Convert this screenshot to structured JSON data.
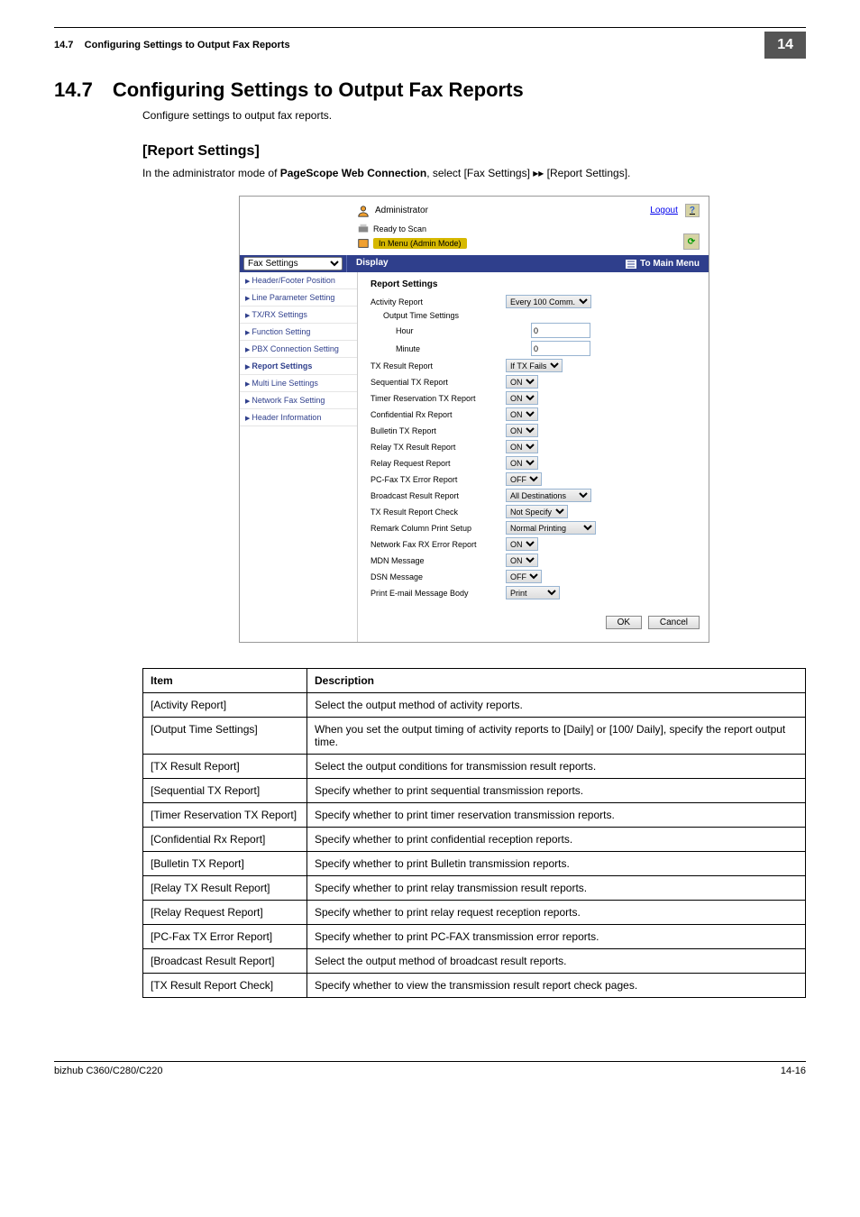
{
  "header": {
    "section_label": "14.7",
    "running_title": "Configuring Settings to Output Fax Reports",
    "chapter_badge": "14"
  },
  "h1": {
    "number": "14.7",
    "title": "Configuring Settings to Output Fax Reports"
  },
  "intro": "Configure settings to output fax reports.",
  "h2": "[Report Settings]",
  "instruction_pre": "In the administrator mode of ",
  "instruction_bold": "PageScope Web Connection",
  "instruction_post": ", select [Fax Settings] ▸▸ [Report Settings].",
  "screenshot": {
    "administrator": "Administrator",
    "logout": "Logout",
    "help": "?",
    "ready": "Ready to Scan",
    "mode": "In Menu (Admin Mode)",
    "dropdown": "Fax Settings",
    "display": "Display",
    "to_main_menu": "To Main Menu",
    "sidebar": [
      "Header/Footer Position",
      "Line Parameter Setting",
      "TX/RX Settings",
      "Function Setting",
      "PBX Connection Setting",
      "Report Settings",
      "Multi Line Settings",
      "Network Fax Setting",
      "Header Information"
    ],
    "panel_title": "Report Settings",
    "rows": {
      "activity_report": {
        "l": "Activity Report",
        "v": "Every 100 Comm."
      },
      "output_time": {
        "l": "Output Time Settings"
      },
      "hour": {
        "l": "Hour",
        "v": "0"
      },
      "minute": {
        "l": "Minute",
        "v": "0"
      },
      "tx_result": {
        "l": "TX Result Report",
        "v": "If TX Fails"
      },
      "seq_tx": {
        "l": "Sequential TX Report",
        "v": "ON"
      },
      "timer_res": {
        "l": "Timer Reservation TX Report",
        "v": "ON"
      },
      "conf_rx": {
        "l": "Confidential Rx Report",
        "v": "ON"
      },
      "bulletin": {
        "l": "Bulletin TX Report",
        "v": "ON"
      },
      "relay_tx": {
        "l": "Relay TX Result Report",
        "v": "ON"
      },
      "relay_req": {
        "l": "Relay Request Report",
        "v": "ON"
      },
      "pcfax_err": {
        "l": "PC-Fax TX Error Report",
        "v": "OFF"
      },
      "bcast": {
        "l": "Broadcast Result Report",
        "v": "All Destinations"
      },
      "tx_check": {
        "l": "TX Result Report Check",
        "v": "Not Specify"
      },
      "remark": {
        "l": "Remark Column Print Setup",
        "v": "Normal Printing"
      },
      "net_fax_err": {
        "l": "Network Fax RX Error Report",
        "v": "ON"
      },
      "mdn": {
        "l": "MDN Message",
        "v": "ON"
      },
      "dsn": {
        "l": "DSN Message",
        "v": "OFF"
      },
      "print_body": {
        "l": "Print E-mail Message Body",
        "v": "Print"
      }
    },
    "ok": "OK",
    "cancel": "Cancel"
  },
  "table": {
    "head_item": "Item",
    "head_desc": "Description",
    "rows": [
      {
        "item": "[Activity Report]",
        "desc": "Select the output method of activity reports."
      },
      {
        "item": "[Output Time Settings]",
        "desc": "When you set the output timing of activity reports to [Daily] or [100/ Daily], specify the report output time."
      },
      {
        "item": "[TX Result Report]",
        "desc": "Select the output conditions for transmission result reports."
      },
      {
        "item": "[Sequential TX Report]",
        "desc": "Specify whether to print sequential transmission reports."
      },
      {
        "item": "[Timer Reservation TX Report]",
        "desc": "Specify whether to print timer reservation transmission reports."
      },
      {
        "item": "[Confidential Rx Report]",
        "desc": "Specify whether to print confidential reception reports."
      },
      {
        "item": "[Bulletin TX Report]",
        "desc": "Specify whether to print Bulletin transmission reports."
      },
      {
        "item": "[Relay TX Result Report]",
        "desc": "Specify whether to print relay transmission result reports."
      },
      {
        "item": "[Relay Request Report]",
        "desc": "Specify whether to print relay request reception reports."
      },
      {
        "item": "[PC-Fax TX Error Report]",
        "desc": "Specify whether to print PC-FAX transmission error reports."
      },
      {
        "item": "[Broadcast Result Report]",
        "desc": "Select the output method of broadcast result reports."
      },
      {
        "item": "[TX Result Report Check]",
        "desc": "Specify whether to view the transmission result report check pages."
      }
    ]
  },
  "footer": {
    "model": "bizhub C360/C280/C220",
    "page": "14-16"
  }
}
